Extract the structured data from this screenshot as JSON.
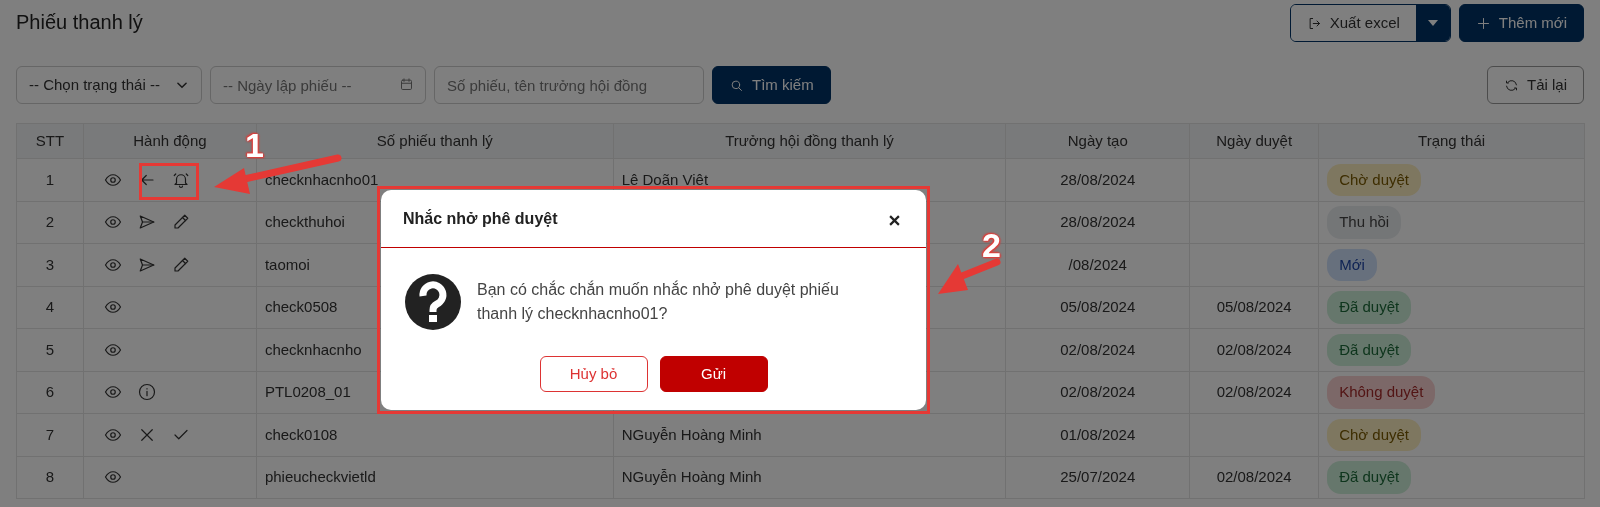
{
  "page": {
    "title": "Phiếu thanh lý"
  },
  "toolbar": {
    "export_button": "Xuất excel",
    "add_button": "Thêm mới"
  },
  "filters": {
    "status_select": "-- Chọn trạng thái --",
    "date_field": {
      "placeholder": "-- Ngày lập phiếu --"
    },
    "search_field": {
      "placeholder": "Số phiếu, tên trưởng hội đồng"
    },
    "search_button": "Tìm kiếm",
    "reload_button": "Tải lại"
  },
  "table": {
    "columns": [
      "STT",
      "Hành động",
      "Số phiếu thanh lý",
      "Trưởng hội đồng thanh lý",
      "Ngày tạo",
      "Ngày duyệt",
      "Trạng thái"
    ],
    "rows": [
      {
        "stt": "1",
        "actions": [
          {
            "kind": "view"
          },
          {
            "kind": "back"
          },
          {
            "kind": "remind"
          }
        ],
        "code": "checknhacnho01",
        "chair": "Lê Doãn Việt",
        "created": "28/08/2024",
        "status": {
          "label": "Chờ duyệt",
          "kind": "pending"
        }
      },
      {
        "stt": "2",
        "actions": [
          {
            "kind": "view"
          },
          {
            "kind": "send"
          },
          {
            "kind": "edit"
          }
        ],
        "code": "checkthuhoi",
        "created": "28/08/2024",
        "status": {
          "label": "Thu hồi",
          "kind": "recalled"
        }
      },
      {
        "stt": "3",
        "actions": [
          {
            "kind": "view"
          },
          {
            "kind": "send"
          },
          {
            "kind": "edit"
          }
        ],
        "code": "taomoi",
        "created": "/08/2024",
        "status": {
          "label": "Mới",
          "kind": "new"
        }
      },
      {
        "stt": "4",
        "actions": [
          {
            "kind": "view"
          }
        ],
        "code": "check0508",
        "created": "05/08/2024",
        "approved": "05/08/2024",
        "status": {
          "label": "Đã duyệt",
          "kind": "approved"
        }
      },
      {
        "stt": "5",
        "actions": [
          {
            "kind": "view"
          }
        ],
        "code": "checknhacnho",
        "created": "02/08/2024",
        "approved": "02/08/2024",
        "status": {
          "label": "Đã duyệt",
          "kind": "approved"
        }
      },
      {
        "stt": "6",
        "actions": [
          {
            "kind": "view"
          },
          {
            "kind": "info"
          }
        ],
        "code": "PTL0208_01",
        "created": "02/08/2024",
        "approved": "02/08/2024",
        "status": {
          "label": "Không duyệt",
          "kind": "rejected"
        }
      },
      {
        "stt": "7",
        "actions": [
          {
            "kind": "view"
          },
          {
            "kind": "reject"
          },
          {
            "kind": "approve"
          }
        ],
        "code": "check0108",
        "chair": "NGuyễn Hoàng Minh",
        "created": "01/08/2024",
        "status": {
          "label": "Chờ duyệt",
          "kind": "pending"
        }
      },
      {
        "stt": "8",
        "actions": [
          {
            "kind": "view"
          }
        ],
        "code": "phieucheckvietld",
        "chair": "NGuyễn Hoàng Minh",
        "created": "25/07/2024",
        "approved": "02/08/2024",
        "status": {
          "label": "Đã duyệt",
          "kind": "approved"
        }
      }
    ]
  },
  "dialog": {
    "title": "Nhắc nhở phê duyệt",
    "message": "Bạn có chắc chắn muốn nhắc nhở phê duyệt phiếu thanh lý checknhacnho01?",
    "buttons": [
      {
        "label": "Hủy bỏ",
        "kind": "secondary"
      },
      {
        "label": "Gửi",
        "kind": "primary"
      }
    ]
  },
  "annotations": [
    {
      "label": "1"
    },
    {
      "label": "2"
    }
  ]
}
